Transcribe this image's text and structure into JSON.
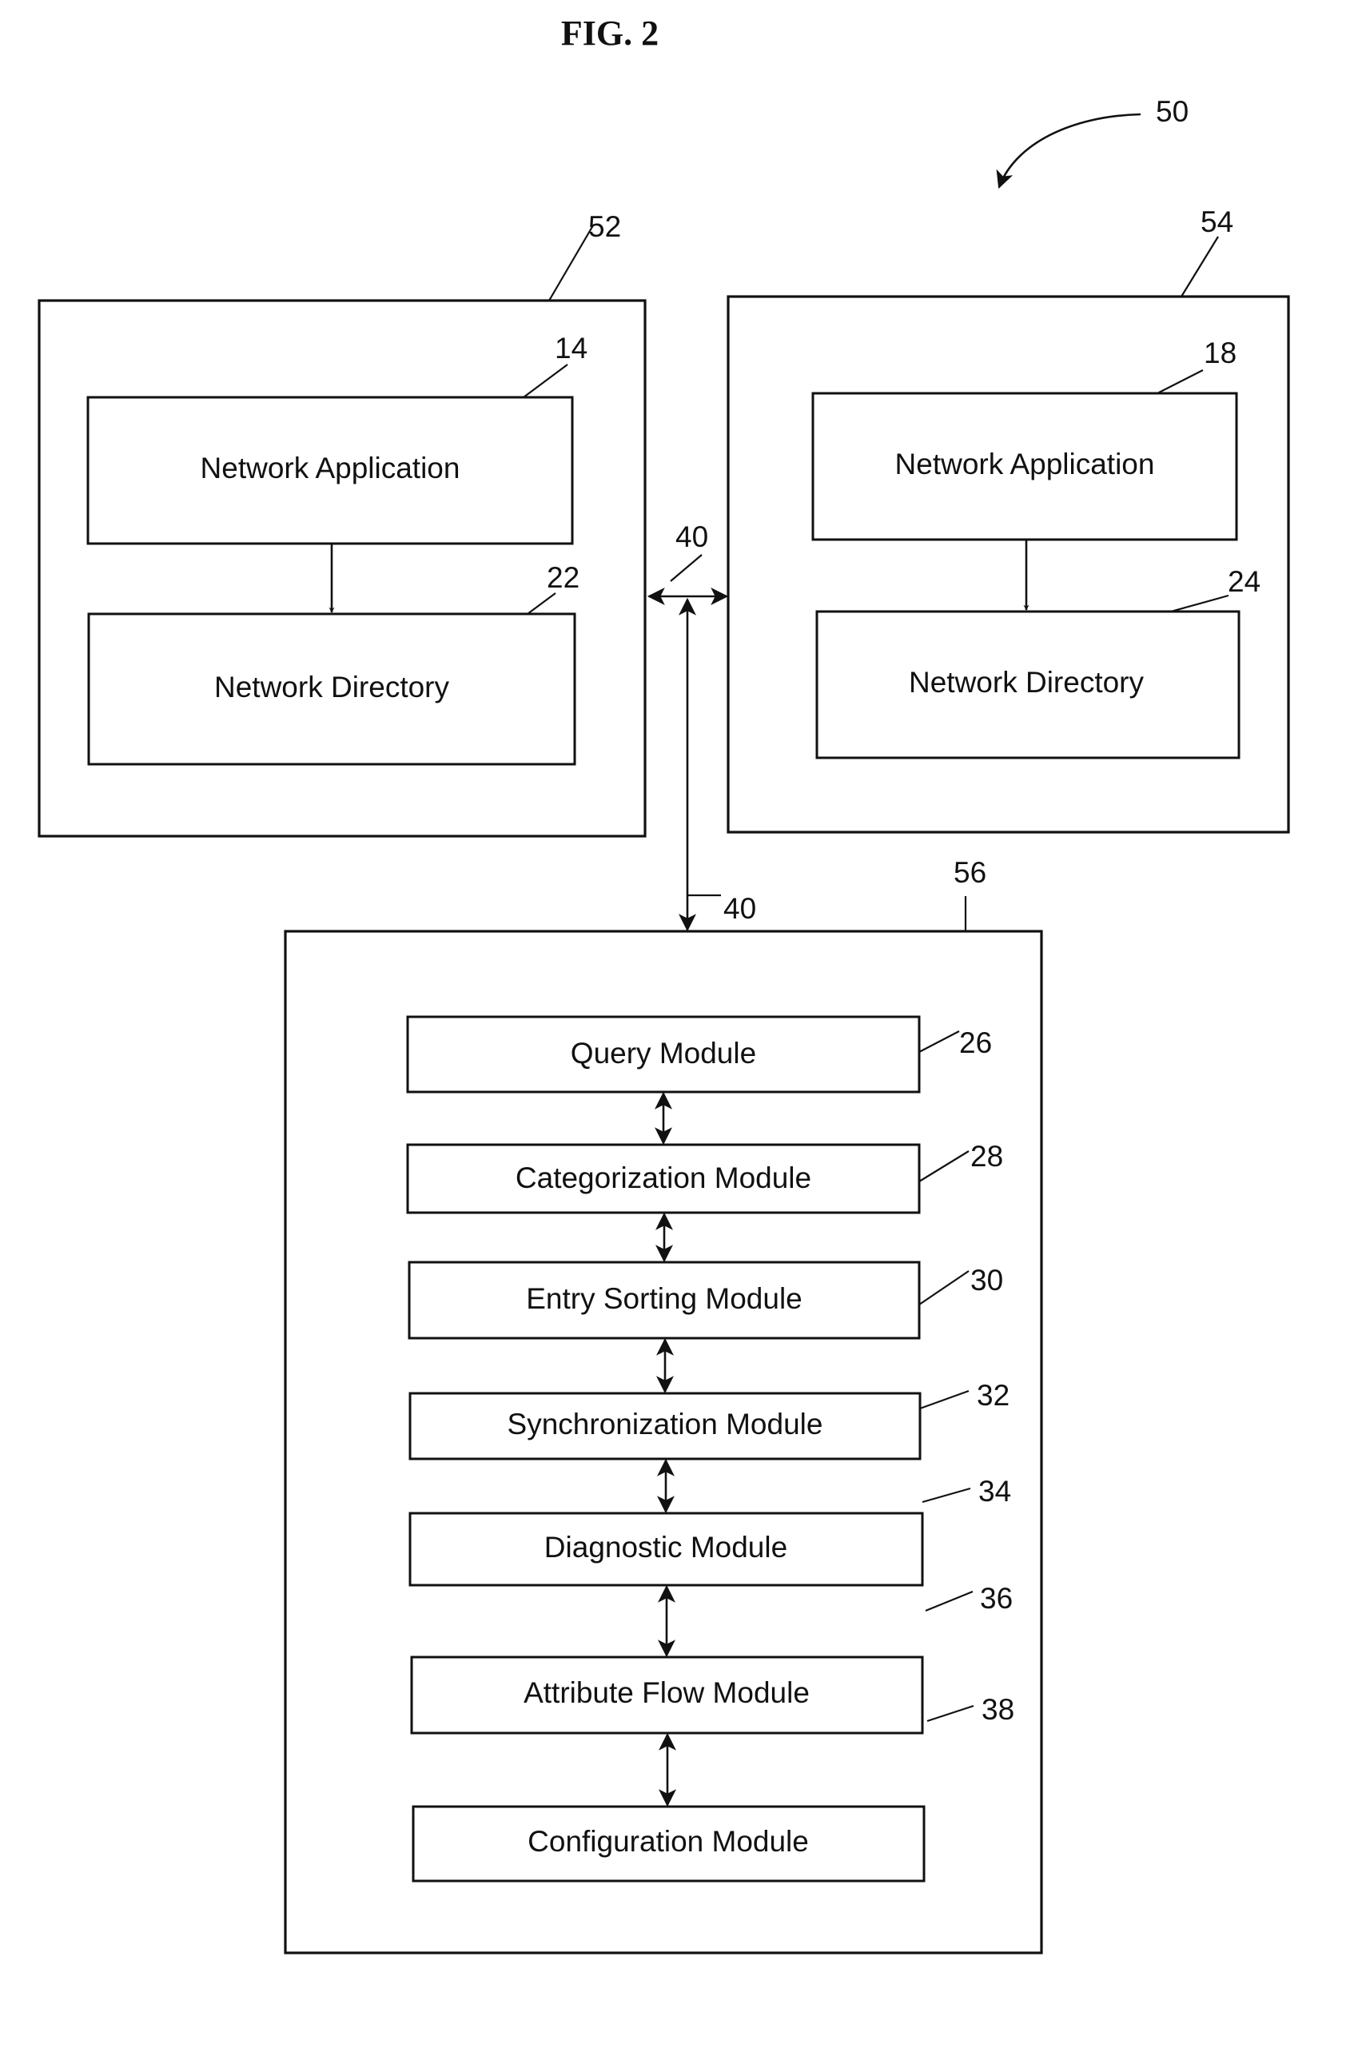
{
  "figure": {
    "title": "FIG. 2",
    "system_ref": "50"
  },
  "systems": {
    "left": {
      "ref": "52",
      "application": {
        "label": "Network Application",
        "ref": "14"
      },
      "directory": {
        "label": "Network Directory",
        "ref": "22"
      }
    },
    "right": {
      "ref": "54",
      "application": {
        "label": "Network Application",
        "ref": "18"
      },
      "directory": {
        "label": "Network Directory",
        "ref": "24"
      }
    }
  },
  "network": {
    "ref_upper": "40",
    "ref_lower": "40"
  },
  "management": {
    "ref": "56",
    "modules": [
      {
        "label": "Query Module",
        "ref": "26"
      },
      {
        "label": "Categorization  Module",
        "ref": "28"
      },
      {
        "label": "Entry Sorting Module",
        "ref": "30"
      },
      {
        "label": "Synchronization Module",
        "ref": "32"
      },
      {
        "label": "Diagnostic Module",
        "ref": "34"
      },
      {
        "label": "Attribute Flow Module",
        "ref": "36"
      },
      {
        "label": "Configuration Module",
        "ref": "38"
      }
    ]
  },
  "colors": {
    "ink": "#111111",
    "paper": "#ffffff"
  }
}
